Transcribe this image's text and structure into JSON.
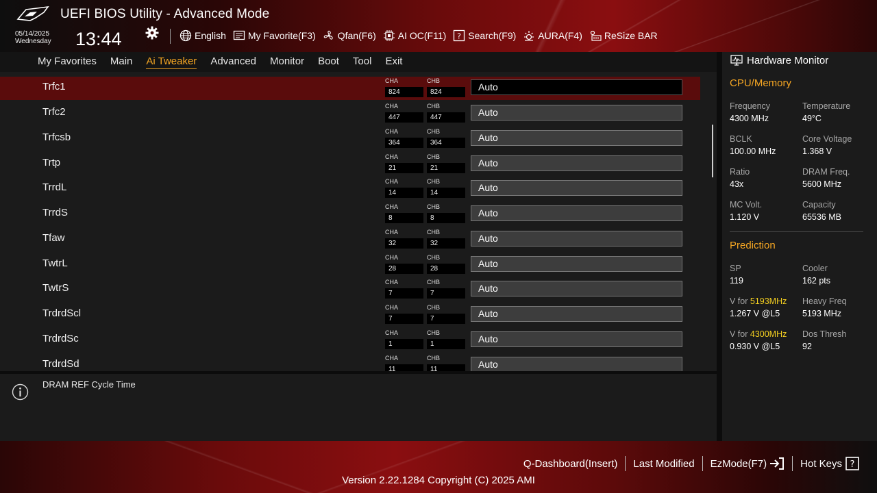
{
  "header": {
    "title": "UEFI BIOS Utility - Advanced Mode",
    "date": "05/14/2025",
    "weekday": "Wednesday",
    "time": "13:44"
  },
  "toolbar": {
    "items": [
      {
        "label": "English",
        "icon": "globe-icon"
      },
      {
        "label": "My Favorite(F3)",
        "icon": "favorite-icon"
      },
      {
        "label": "Qfan(F6)",
        "icon": "fan-icon"
      },
      {
        "label": "AI OC(F11)",
        "icon": "ai-chip-icon"
      },
      {
        "label": "Search(F9)",
        "icon": "search-icon"
      },
      {
        "label": "AURA(F4)",
        "icon": "aura-light-icon"
      },
      {
        "label": "ReSize BAR",
        "icon": "resize-bar-icon"
      }
    ]
  },
  "nav": {
    "tabs": [
      "My Favorites",
      "Main",
      "Ai Tweaker",
      "Advanced",
      "Monitor",
      "Boot",
      "Tool",
      "Exit"
    ],
    "active": "Ai Tweaker"
  },
  "settings": {
    "rows": [
      {
        "label": "Trfc1",
        "cha_label": "CHA",
        "chb_label": "CHB",
        "cha": "824",
        "chb": "824",
        "value": "Auto"
      },
      {
        "label": "Trfc2",
        "cha_label": "CHA",
        "chb_label": "CHB",
        "cha": "447",
        "chb": "447",
        "value": "Auto"
      },
      {
        "label": "Trfcsb",
        "cha_label": "CHA",
        "chb_label": "CHB",
        "cha": "364",
        "chb": "364",
        "value": "Auto"
      },
      {
        "label": "Trtp",
        "cha_label": "CHA",
        "chb_label": "CHB",
        "cha": "21",
        "chb": "21",
        "value": "Auto"
      },
      {
        "label": "TrrdL",
        "cha_label": "CHA",
        "chb_label": "CHB",
        "cha": "14",
        "chb": "14",
        "value": "Auto"
      },
      {
        "label": "TrrdS",
        "cha_label": "CHA",
        "chb_label": "CHB",
        "cha": "8",
        "chb": "8",
        "value": "Auto"
      },
      {
        "label": "Tfaw",
        "cha_label": "CHA",
        "chb_label": "CHB",
        "cha": "32",
        "chb": "32",
        "value": "Auto"
      },
      {
        "label": "TwtrL",
        "cha_label": "CHA",
        "chb_label": "CHB",
        "cha": "28",
        "chb": "28",
        "value": "Auto"
      },
      {
        "label": "TwtrS",
        "cha_label": "CHA",
        "chb_label": "CHB",
        "cha": "7",
        "chb": "7",
        "value": "Auto"
      },
      {
        "label": "TrdrdScl",
        "cha_label": "CHA",
        "chb_label": "CHB",
        "cha": "7",
        "chb": "7",
        "value": "Auto"
      },
      {
        "label": "TrdrdSc",
        "cha_label": "CHA",
        "chb_label": "CHB",
        "cha": "1",
        "chb": "1",
        "value": "Auto"
      },
      {
        "label": "TrdrdSd",
        "cha_label": "CHA",
        "chb_label": "CHB",
        "cha": "11",
        "chb": "11",
        "value": "Auto"
      }
    ],
    "selected_index": 0
  },
  "help": {
    "text": "DRAM REF Cycle Time"
  },
  "hardware_monitor": {
    "title": "Hardware Monitor",
    "cpu_memory": {
      "section": "CPU/Memory",
      "frequency_label": "Frequency",
      "frequency": "4300 MHz",
      "temperature_label": "Temperature",
      "temperature": "49°C",
      "bclk_label": "BCLK",
      "bclk": "100.00 MHz",
      "core_voltage_label": "Core Voltage",
      "core_voltage": "1.368 V",
      "ratio_label": "Ratio",
      "ratio": "43x",
      "dram_freq_label": "DRAM Freq.",
      "dram_freq": "5600 MHz",
      "mc_volt_label": "MC Volt.",
      "mc_volt": "1.120 V",
      "capacity_label": "Capacity",
      "capacity": "65536 MB"
    },
    "prediction": {
      "section": "Prediction",
      "sp_label": "SP",
      "sp": "119",
      "cooler_label": "Cooler",
      "cooler": "162 pts",
      "v_for_prefix": "V for ",
      "v_for_1_freq": "5193MHz",
      "v_for_1": "1.267 V @L5",
      "heavy_freq_label": "Heavy Freq",
      "heavy_freq": "5193 MHz",
      "v_for_2_freq": "4300MHz",
      "v_for_2": "0.930 V @L5",
      "dos_thresh_label": "Dos Thresh",
      "dos_thresh": "92"
    }
  },
  "footer": {
    "actions": [
      "Q-Dashboard(Insert)",
      "Last Modified",
      "EzMode(F7)",
      "Hot Keys"
    ],
    "version": "Version 2.22.1284 Copyright (C) 2025 AMI"
  },
  "colors": {
    "accent": "#f5a623",
    "highlight": "#f5d020",
    "selected_row": "#5a0c0c"
  }
}
